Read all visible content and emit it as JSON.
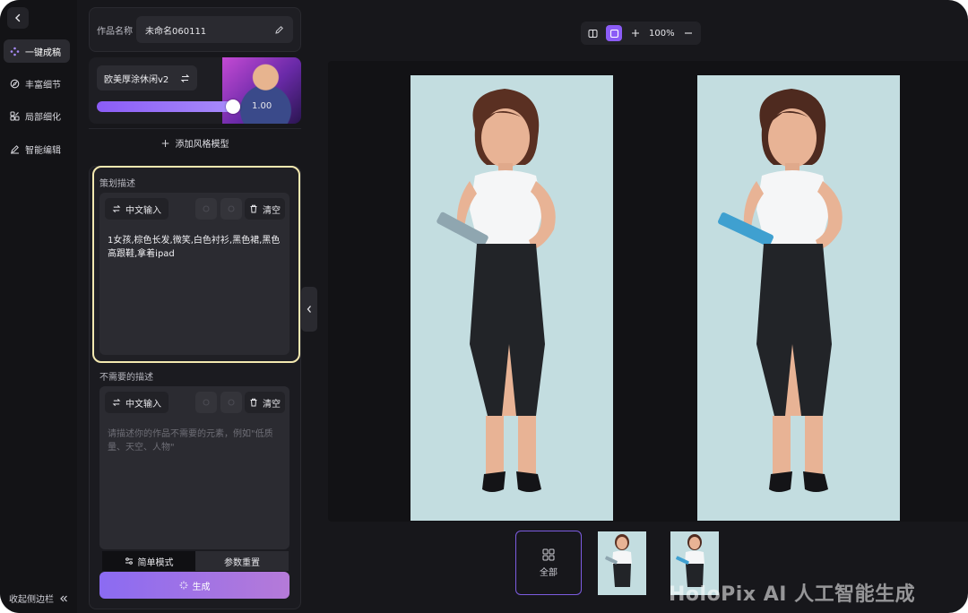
{
  "nav": {
    "items": [
      {
        "label": "一键成稿",
        "icon": "sparkle-icon",
        "active": true
      },
      {
        "label": "丰富细节",
        "icon": "compass-icon",
        "active": false
      },
      {
        "label": "局部细化",
        "icon": "grid-edit-icon",
        "active": false
      },
      {
        "label": "智能编辑",
        "icon": "pen-icon",
        "active": false
      }
    ],
    "collapse_label": "收起侧边栏"
  },
  "work": {
    "name_label": "作品名称",
    "name_value": "未命名060111"
  },
  "style": {
    "model_name": "欧美厚涂休闲v2",
    "strength": "1.00",
    "strength_fraction": 0.95,
    "add_label": "添加风格模型"
  },
  "prompt": {
    "title": "策划描述",
    "translate_label": "中文输入",
    "clear_label": "清空",
    "text": "1女孩,棕色长发,微笑,白色衬衫,黑色裙,黑色高跟鞋,拿着ipad"
  },
  "negative": {
    "title": "不需要的描述",
    "translate_label": "中文输入",
    "clear_label": "清空",
    "placeholder": "请描述你的作品不需要的元素，例如\"低质量、天空、人物\""
  },
  "modes": {
    "simple_label": "简单模式",
    "params_label": "参数重置"
  },
  "generate_label": "生成",
  "toolbar": {
    "zoom": "100%"
  },
  "thumbs": {
    "all_label": "全部"
  },
  "watermark": "HoloPix AI 人工智能生成",
  "colors": {
    "accent": "#8b5cf6",
    "highlight_border": "#f3e8b0",
    "image_bg": "#c3dde0"
  }
}
